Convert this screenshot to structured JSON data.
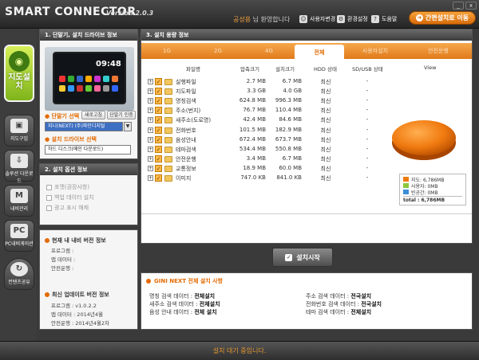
{
  "title": {
    "app_name": "SMART CONNECTOR",
    "version": "Version 2.0.3",
    "minimize": "_",
    "close": "x"
  },
  "header": {
    "greeting_name": "공성용",
    "greeting_rest": "님 환영합니다",
    "links": [
      "사용자변경",
      "환경설정",
      "도움말"
    ],
    "quick_install": "간편설치로 이동"
  },
  "nav": {
    "items": [
      {
        "label": "지도설치",
        "icon": "map-icon"
      },
      {
        "label": "지도구입",
        "icon": "cart-icon"
      },
      {
        "label": "솔루션 다운로드",
        "icon": "download-icon"
      },
      {
        "label": "내비관리",
        "icon": "navi-icon"
      },
      {
        "label": "PC내비게이션",
        "icon": "pc-icon"
      },
      {
        "label": "컨텐츠공유",
        "icon": "share-icon"
      }
    ]
  },
  "panel1": {
    "title": "1. 단말기, 설치 드라이브 정보",
    "device_time": "09:48",
    "device_label": "단말기 선택",
    "btn_refresh": "새로고침",
    "btn_auth": "단말기 인증",
    "device_value": "지니(NEXT) (주)파인디지털",
    "drive_label": "설치 드라이브 선택",
    "drive_value": "하드 디스크(메인 다운로드)"
  },
  "panel2": {
    "title": "2. 설치 옵션 정보",
    "options": [
      "포맷(권장사항)",
      "백업 데이터 설치",
      "광고 표시 해제"
    ]
  },
  "version_info": {
    "current_title": "현재 내 내비 버전 정보",
    "current_rows": [
      "프로그램 :",
      "맵 데이터 :",
      "안전운행 :"
    ],
    "latest_title": "최신 업데이트 버전 정보",
    "latest_rows": [
      "프로그램 : v1.0.2.2",
      "맵 데이터 : 2014년4월",
      "안전운행 : 2014년4월2차"
    ]
  },
  "panel3": {
    "title": "3. 설치 용량 정보",
    "tabs": [
      "1G",
      "2G",
      "4G",
      "전체",
      "사용자설치",
      "안전운행"
    ],
    "columns": [
      "파일명",
      "압축크기",
      "설치크기",
      "HDD 상태",
      "SD/USB 상태",
      "View"
    ],
    "rows": [
      {
        "name": "실행파일",
        "comp": "2.7 MB",
        "inst": "6.7 MB",
        "hdd": "최신",
        "sd": "-"
      },
      {
        "name": "지도파일",
        "comp": "3.3 GB",
        "inst": "4.0 GB",
        "hdd": "최신",
        "sd": "-"
      },
      {
        "name": "명칭검색",
        "comp": "624.8 MB",
        "inst": "996.3 MB",
        "hdd": "최신",
        "sd": "-"
      },
      {
        "name": "주소(번지)",
        "comp": "76.7 MB",
        "inst": "110.4 MB",
        "hdd": "최신",
        "sd": "-"
      },
      {
        "name": "새주소(도로명)",
        "comp": "42.4 MB",
        "inst": "84.6 MB",
        "hdd": "최신",
        "sd": "-"
      },
      {
        "name": "전화번호",
        "comp": "101.5 MB",
        "inst": "182.9 MB",
        "hdd": "최신",
        "sd": "-"
      },
      {
        "name": "음성안내",
        "comp": "672.4 MB",
        "inst": "673.7 MB",
        "hdd": "최신",
        "sd": "-"
      },
      {
        "name": "테마검색",
        "comp": "534.4 MB",
        "inst": "550.8 MB",
        "hdd": "최신",
        "sd": "-"
      },
      {
        "name": "안전운행",
        "comp": "3.4 MB",
        "inst": "6.7 MB",
        "hdd": "최신",
        "sd": "-"
      },
      {
        "name": "교통정보",
        "comp": "18.9 MB",
        "inst": "60.0 MB",
        "hdd": "최신",
        "sd": "-"
      },
      {
        "name": "이미지",
        "comp": "747.0 KB",
        "inst": "841.0 KB",
        "hdd": "최신",
        "sd": "-"
      }
    ],
    "legend": {
      "map": "지도: 6,786MB",
      "used": "사용자: 0MB",
      "free": "빈공간: 0MB",
      "total": "total : 6,786MB"
    },
    "legend_colors": {
      "map": "#f07a10",
      "used": "#8dc63f",
      "free": "#3a8fd6"
    },
    "install_button": "설치시작"
  },
  "notes": {
    "title": "GINI NEXT 전체 설치 사항",
    "left": [
      {
        "k": "명칭 검색 데이터",
        "v": "전체설치"
      },
      {
        "k": "새주소 검색 데이터",
        "v": "전체설치"
      },
      {
        "k": "음성 안내 데이터",
        "v": "전체 설치"
      }
    ],
    "right": [
      {
        "k": "주소 검색 데이터",
        "v": "전국설치"
      },
      {
        "k": "전화번호 검색 데이터",
        "v": "전국설치"
      },
      {
        "k": "테마 검색 데이터",
        "v": "전체설치"
      }
    ]
  },
  "status": {
    "text": "설치 대기 중입니다."
  }
}
